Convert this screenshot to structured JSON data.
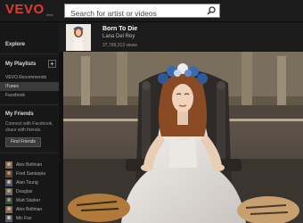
{
  "brand": {
    "logo": "VEVO",
    "logo_sub": "beta"
  },
  "search": {
    "placeholder": "Search for artist or videos"
  },
  "sidebar": {
    "explore": "Explore",
    "playlists_title": "My Playlists",
    "playlists": [
      {
        "label": "VEVO Recommends"
      },
      {
        "label": "iTunes"
      },
      {
        "label": "Facebook"
      }
    ],
    "friends_title": "My Friends",
    "friends_desc": "Connect with Facebook, share with friends.",
    "find_friends": "Find Friends",
    "friends": [
      {
        "name": "Alex Bellman"
      },
      {
        "name": "Fred Santarpia"
      },
      {
        "name": "Alan Tsung"
      },
      {
        "name": "Douglas"
      },
      {
        "name": "Matt Starker"
      },
      {
        "name": "Alex Bellman"
      },
      {
        "name": "Mic Fox"
      }
    ]
  },
  "now_playing": {
    "title": "Born To Die",
    "artist": "Lana Del Rey",
    "views": "37,799,313 views"
  },
  "colors": {
    "brand_red": "#e23b2e",
    "sidebar_bg": "#171717",
    "topbar_bg": "#1b1b1b"
  }
}
